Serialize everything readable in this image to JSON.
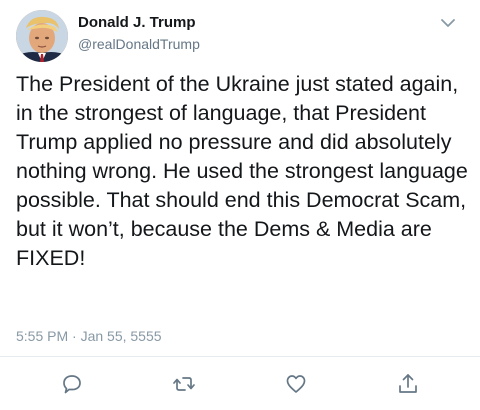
{
  "author": {
    "name": "Donald J. Trump",
    "handle": "@realDonaldTrump",
    "avatar_icon": "profile-avatar"
  },
  "tweet": {
    "text": "The President of the Ukraine just stated again, in the strongest of language, that President Trump applied no pressure and did absolutely nothing wrong. He used the strongest language possible. That should end this Democrat Scam, but it won’t, because the Dems & Media are FIXED!",
    "timestamp": "5:55 PM · Jan 55, 5555"
  },
  "actions": [
    {
      "name": "reply",
      "icon": "comment-icon"
    },
    {
      "name": "retweet",
      "icon": "retweet-icon"
    },
    {
      "name": "like",
      "icon": "heart-icon"
    },
    {
      "name": "share",
      "icon": "share-icon"
    }
  ],
  "colors": {
    "text": "#14171a",
    "secondary": "#657786",
    "muted": "#8899a6",
    "icon": "#657786",
    "divider": "#e6ecf0"
  }
}
